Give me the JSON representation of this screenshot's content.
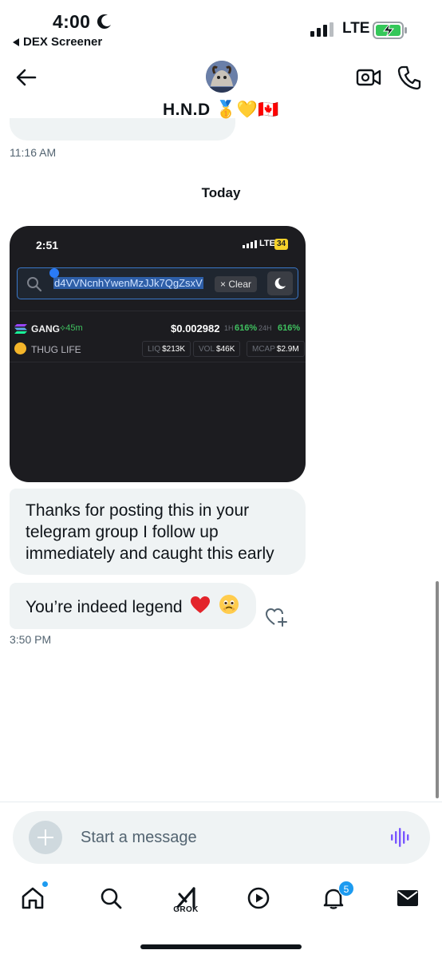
{
  "status_bar": {
    "time": "4:00",
    "back_app_label": "DEX Screener",
    "network": "LTE"
  },
  "header": {
    "contact_name": "H.N.D 🥇💛🇨🇦"
  },
  "messages": {
    "prev_timestamp": "11:16 AM",
    "day_label": "Today",
    "shared_screenshot": {
      "time": "2:51",
      "network": "LTE",
      "battery": "34",
      "search_text": "d4VVNcnhYwenMzJJk7QgZsxV",
      "clear_label": "× Clear",
      "token": {
        "symbol": "GANG",
        "age": "45m",
        "price": "$0.002982",
        "change_1h_label": "1H",
        "change_1h": "616%",
        "change_24h_label": "24H",
        "change_24h": "616%",
        "name": "THUG LIFE",
        "liq_label": "LIQ",
        "liq": "$213K",
        "vol_label": "VOL",
        "vol": "$46K",
        "mcap_label": "MCAP",
        "mcap": "$2.9M"
      }
    },
    "message_1": "Thanks for posting this in your telegram group I follow up immediately and caught this early",
    "message_2": "You’re indeed legend",
    "message_2_emojis": [
      "heart",
      "face-holding-back-tears"
    ],
    "last_timestamp": "3:50 PM"
  },
  "composer": {
    "placeholder": "Start a message"
  },
  "tabbar": {
    "grok_label": "GROK",
    "notification_count": "5"
  },
  "colors": {
    "accent": "#1d9bf0",
    "bubble_bg": "#eff3f4",
    "voice_purple": "#7856ff",
    "dex_green": "#3fc15f"
  }
}
